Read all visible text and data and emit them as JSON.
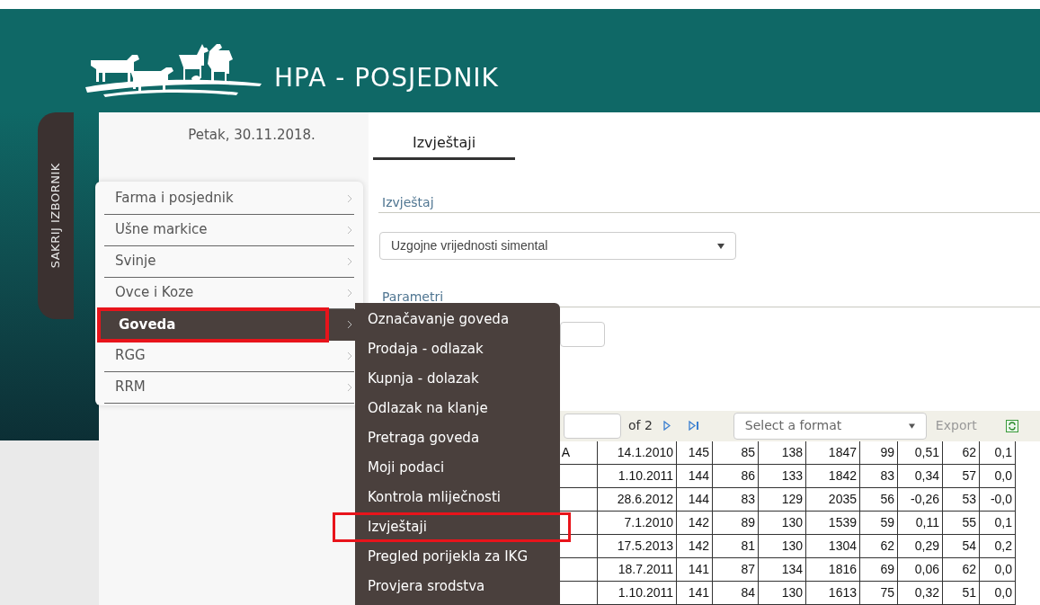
{
  "header": {
    "title": "HPA - POSJEDNIK"
  },
  "sidebar": {
    "toggle_label": "SAKRIJ IZBORNIK",
    "date": "Petak, 30.11.2018.",
    "items": [
      {
        "label": "Farma i posjednik",
        "selected": false,
        "highlighted": false
      },
      {
        "label": "Ušne markice",
        "selected": false,
        "highlighted": false
      },
      {
        "label": "Svinje",
        "selected": false,
        "highlighted": false
      },
      {
        "label": "Ovce i Koze",
        "selected": false,
        "highlighted": false
      },
      {
        "label": "Goveda",
        "selected": true,
        "highlighted": true
      },
      {
        "label": "RGG",
        "selected": false,
        "highlighted": false
      },
      {
        "label": "RRM",
        "selected": false,
        "highlighted": false
      }
    ]
  },
  "submenu": {
    "items": [
      {
        "label": "Označavanje goveda",
        "highlighted": false
      },
      {
        "label": "Prodaja - odlazak",
        "highlighted": false
      },
      {
        "label": "Kupnja - dolazak",
        "highlighted": false
      },
      {
        "label": "Odlazak na klanje",
        "highlighted": false
      },
      {
        "label": "Pretraga goveda",
        "highlighted": false
      },
      {
        "label": "Moji podaci",
        "highlighted": false
      },
      {
        "label": "Kontrola mliječnosti",
        "highlighted": false
      },
      {
        "label": "Izvještaji",
        "highlighted": true
      },
      {
        "label": "Pregled porijekla za IKG",
        "highlighted": false
      },
      {
        "label": "Provjera srodstva",
        "highlighted": false
      }
    ]
  },
  "main": {
    "tab": "Izvještaji",
    "report_section": "Izvještaj",
    "report_select": "Uzgojne vrijednosti simental",
    "params_section": "Parametri",
    "toolbar": {
      "page_of": "of 2",
      "format_placeholder": "Select a format",
      "export": "Export"
    },
    "table": {
      "rows": [
        {
          "name": "A",
          "cells": [
            "14.1.2010",
            "145",
            "85",
            "138",
            "1847",
            "99",
            "0,51",
            "62",
            "0,1"
          ]
        },
        {
          "cells": [
            "1.10.2011",
            "144",
            "86",
            "133",
            "1842",
            "83",
            "0,34",
            "57",
            "0,0"
          ]
        },
        {
          "cells": [
            "28.6.2012",
            "144",
            "83",
            "129",
            "2035",
            "56",
            "-0,26",
            "53",
            "-0,0"
          ]
        },
        {
          "cells": [
            "7.1.2010",
            "142",
            "89",
            "130",
            "1539",
            "59",
            "0,11",
            "55",
            "0,1"
          ]
        },
        {
          "cells": [
            "17.5.2013",
            "142",
            "81",
            "130",
            "1304",
            "62",
            "0,29",
            "54",
            "0,2"
          ]
        },
        {
          "cells": [
            "18.7.2011",
            "141",
            "87",
            "134",
            "1816",
            "69",
            "0,06",
            "62",
            "0,0"
          ]
        },
        {
          "cells": [
            "1.10.2011",
            "141",
            "84",
            "130",
            "1613",
            "75",
            "0,32",
            "51",
            "0,0"
          ]
        }
      ]
    }
  }
}
